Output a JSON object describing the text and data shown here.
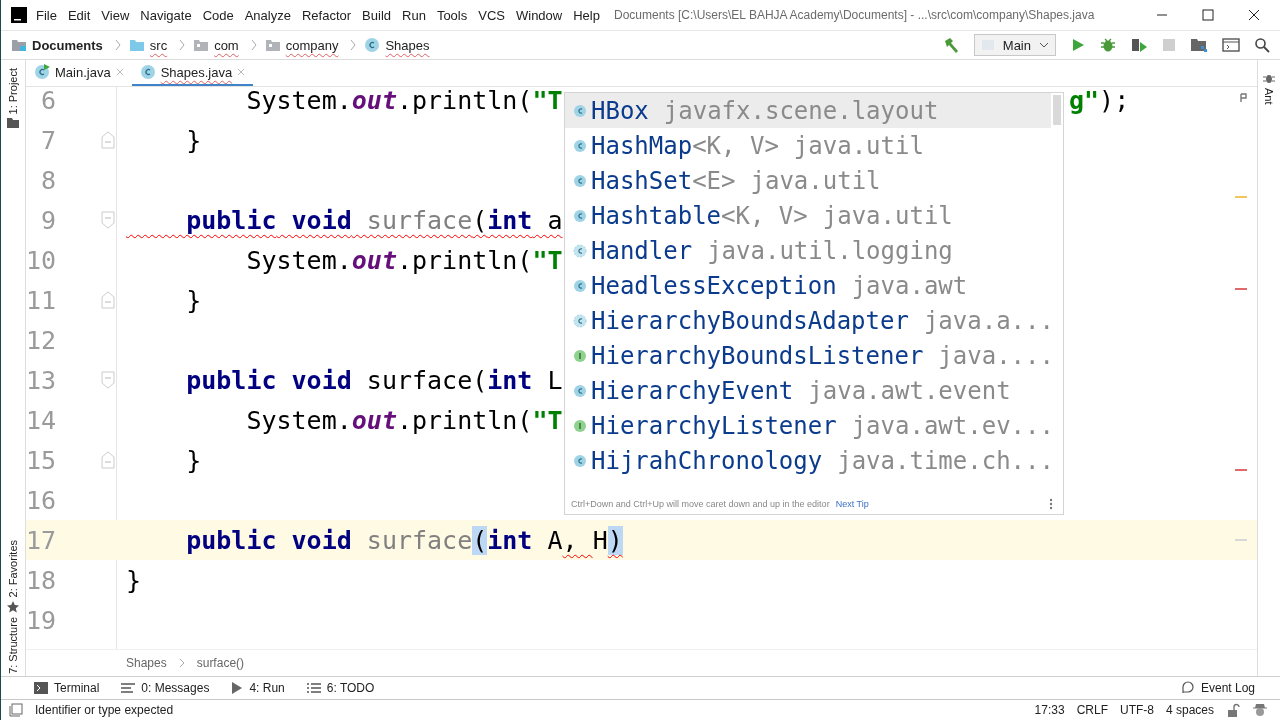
{
  "menu": [
    "File",
    "Edit",
    "View",
    "Navigate",
    "Code",
    "Analyze",
    "Refactor",
    "Build",
    "Run",
    "Tools",
    "VCS",
    "Window",
    "Help"
  ],
  "window": {
    "title": "Documents [C:\\Users\\EL BAHJA Academy\\Documents] - ...\\src\\com\\company\\Shapes.java"
  },
  "navbar": {
    "path": [
      {
        "label": "Documents",
        "kind": "project"
      },
      {
        "label": "src",
        "kind": "source"
      },
      {
        "label": "com",
        "kind": "package"
      },
      {
        "label": "company",
        "kind": "package"
      },
      {
        "label": "Shapes",
        "kind": "class"
      }
    ],
    "run_config": "Main"
  },
  "tabs": [
    {
      "label": "Main.java",
      "selected": false,
      "kind": "main"
    },
    {
      "label": "Shapes.java",
      "selected": true,
      "kind": "class"
    }
  ],
  "left_tools": [
    "1: Project",
    "2: Favorites",
    "7: Structure"
  ],
  "right_tools": [
    "Ant"
  ],
  "code": [
    {
      "number": "6",
      "current": false,
      "kind": "plain",
      "tokens": [
        {
          "text": "        System.",
          "kind": "plain",
          "error": false
        },
        {
          "text": "out",
          "kind": "field",
          "error": false
        },
        {
          "text": ".println(",
          "kind": "plain",
          "error": false
        },
        {
          "text": "\"T",
          "kind": "string",
          "error": false
        }
      ],
      "tail": [
        {
          "text": "g\"",
          "kind": "string"
        },
        {
          "text": ");",
          "kind": "plain"
        }
      ]
    },
    {
      "number": "7",
      "current": false,
      "kind": "closer",
      "tokens": [
        {
          "text": "    }",
          "kind": "plain",
          "error": false
        }
      ]
    },
    {
      "number": "8",
      "current": false,
      "kind": "plain"
    },
    {
      "number": "9",
      "current": false,
      "kind": "opener",
      "tokens": [
        {
          "text": "    public",
          "kind": "keyword",
          "error": true
        },
        {
          "text": " void",
          "kind": "keyword",
          "error": true
        },
        {
          "text": " surface",
          "kind": "unused",
          "error": true
        },
        {
          "text": "(",
          "kind": "plain",
          "error": true
        },
        {
          "text": "int",
          "kind": "keyword",
          "error": true
        },
        {
          "text": " a",
          "kind": "plain",
          "error": true
        }
      ]
    },
    {
      "number": "10",
      "current": false,
      "kind": "plain",
      "tokens": [
        {
          "text": "        System.",
          "kind": "plain",
          "error": false
        },
        {
          "text": "out",
          "kind": "field",
          "error": false
        },
        {
          "text": ".println(",
          "kind": "plain",
          "error": false
        },
        {
          "text": "\"T",
          "kind": "string",
          "error": false
        }
      ]
    },
    {
      "number": "11",
      "current": false,
      "kind": "closer",
      "tokens": [
        {
          "text": "    }",
          "kind": "plain",
          "error": false
        }
      ]
    },
    {
      "number": "12",
      "current": false,
      "kind": "plain"
    },
    {
      "number": "13",
      "current": false,
      "kind": "opener",
      "tokens": [
        {
          "text": "    public",
          "kind": "keyword",
          "error": false
        },
        {
          "text": " void",
          "kind": "keyword",
          "error": false
        },
        {
          "text": " surface(",
          "kind": "plain",
          "error": false
        },
        {
          "text": "int",
          "kind": "keyword",
          "error": false
        },
        {
          "text": " L",
          "kind": "plain",
          "error": false
        }
      ]
    },
    {
      "number": "14",
      "current": false,
      "kind": "plain",
      "tokens": [
        {
          "text": "        System.",
          "kind": "plain",
          "error": false
        },
        {
          "text": "out",
          "kind": "field",
          "error": false
        },
        {
          "text": ".println(",
          "kind": "plain",
          "error": false
        },
        {
          "text": "\"T",
          "kind": "string",
          "error": false
        }
      ]
    },
    {
      "number": "15",
      "current": false,
      "kind": "closer",
      "tokens": [
        {
          "text": "    }",
          "kind": "plain",
          "error": false
        }
      ]
    },
    {
      "number": "16",
      "current": false,
      "kind": "plain"
    },
    {
      "number": "17",
      "current": true,
      "kind": "plain",
      "tokens": [
        {
          "text": "    public",
          "kind": "keyword",
          "error": false
        },
        {
          "text": " void",
          "kind": "keyword",
          "error": false
        },
        {
          "text": " surface",
          "kind": "unused",
          "error": false
        },
        {
          "text": "(",
          "kind": "match",
          "error": false
        },
        {
          "text": "int",
          "kind": "keyword",
          "error": false
        },
        {
          "text": " A",
          "kind": "plain",
          "error": false
        },
        {
          "text": ", ",
          "kind": "plain",
          "error": true
        },
        {
          "text": "H",
          "kind": "plain",
          "error": false
        },
        {
          "text": ")",
          "kind": "match",
          "error": true
        }
      ]
    },
    {
      "number": "18",
      "current": false,
      "kind": "plain",
      "tokens": [
        {
          "text": "}",
          "kind": "plain",
          "error": false
        }
      ]
    },
    {
      "number": "19",
      "current": false,
      "kind": "plain"
    }
  ],
  "completion": {
    "items": [
      {
        "name": "HBox",
        "package": "javafx.scene.layout",
        "kind": "class",
        "selected": true
      },
      {
        "name": "HashMap",
        "params": "<K, V>",
        "package": "java.util",
        "kind": "class",
        "selected": false
      },
      {
        "name": "HashSet",
        "params": "<E>",
        "package": "java.util",
        "kind": "class",
        "selected": false
      },
      {
        "name": "Hashtable",
        "params": "<K, V>",
        "package": "java.util",
        "kind": "class",
        "selected": false
      },
      {
        "name": "Handler",
        "package": "java.util.logging",
        "kind": "abstract",
        "selected": false
      },
      {
        "name": "HeadlessException",
        "package": "java.awt",
        "kind": "class",
        "selected": false
      },
      {
        "name": "HierarchyBoundsAdapter",
        "package": "java.a...",
        "kind": "abstract",
        "selected": false
      },
      {
        "name": "HierarchyBoundsListener",
        "package": "java....",
        "kind": "interface",
        "selected": false
      },
      {
        "name": "HierarchyEvent",
        "package": "java.awt.event",
        "kind": "class",
        "selected": false
      },
      {
        "name": "HierarchyListener",
        "package": "java.awt.ev...",
        "kind": "interface",
        "selected": false
      },
      {
        "name": "HijrahChronology",
        "package": "java.time.ch...",
        "kind": "class",
        "selected": false
      }
    ],
    "hint": "Ctrl+Down and Ctrl+Up will move caret down and up in the editor",
    "next_tip": "Next Tip"
  },
  "breadcrumb": [
    "Shapes",
    "surface()"
  ],
  "tool_windows": [
    {
      "label": "Terminal",
      "kind": "terminal"
    },
    {
      "label": "0: Messages",
      "kind": "messages"
    },
    {
      "label": "4: Run",
      "kind": "run"
    },
    {
      "label": "6: TODO",
      "kind": "todo"
    }
  ],
  "event_log": "Event Log",
  "status_bar": {
    "message": "Identifier or type expected",
    "position": "17:33",
    "line_separator": "CRLF",
    "encoding": "UTF-8",
    "indent": "4 spaces"
  }
}
